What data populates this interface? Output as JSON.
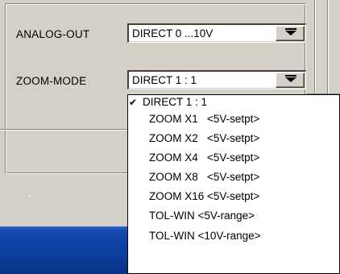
{
  "analog_out": {
    "label": "ANALOG-OUT",
    "value": "DIRECT 0 ...10V"
  },
  "zoom_mode": {
    "label": "ZOOM-MODE",
    "value": "DIRECT 1 : 1"
  },
  "dropdown": {
    "selected_index": 0,
    "check_glyph": "✔",
    "items": [
      "DIRECT 1 : 1",
      "ZOOM X1   <5V-setpt>",
      "ZOOM X2   <5V-setpt>",
      "ZOOM X4   <5V-setpt>",
      "ZOOM X8   <5V-setpt>",
      "ZOOM X16 <5V-setpt>",
      "TOL-WIN <5V-range>",
      "TOL-WIN <10V-range>"
    ]
  },
  "icons": {
    "combo_arrow": "chevron-down-icon",
    "selected_mark": "checkmark-icon"
  },
  "colors": {
    "window_bg": "#d4d0c8",
    "list_bg": "#ffffff",
    "title_bar_blue": "#0a3c98"
  }
}
